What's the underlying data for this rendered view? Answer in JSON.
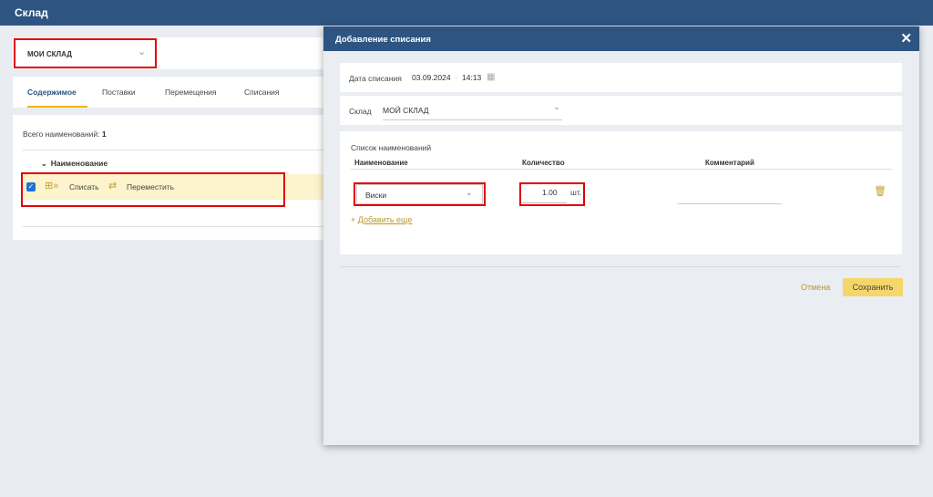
{
  "app": {
    "title": "Склад"
  },
  "warehouse_selector": {
    "value": "МОИ СКЛАД"
  },
  "tabs": [
    {
      "label": "Содержимое",
      "active": true
    },
    {
      "label": "Поставки"
    },
    {
      "label": "Перемещения"
    },
    {
      "label": "Списания"
    }
  ],
  "content": {
    "total_label": "Всего наименований:",
    "total_value": "1",
    "column_name": "Наименование",
    "actions": {
      "write_off": "Списать",
      "move": "Переместить"
    }
  },
  "modal": {
    "title": "Добавление списания",
    "date": {
      "label": "Дата списания",
      "date": "03.09.2024",
      "separator": "·",
      "time": "14:13"
    },
    "warehouse": {
      "label": "Склад",
      "value": "МОЙ СКЛАД"
    },
    "list": {
      "title": "Список наименований",
      "columns": {
        "name": "Наименование",
        "quantity": "Количество",
        "comment": "Комментарий"
      },
      "rows": [
        {
          "name": "Виски",
          "quantity": "1.00",
          "unit": "шт.",
          "comment": ""
        }
      ],
      "add_more": "Добавить еще"
    },
    "buttons": {
      "cancel": "Отмена",
      "save": "Сохранить"
    }
  },
  "colors": {
    "header": "#2e5481",
    "accent": "#f0b700",
    "highlight": "#fdf3cc",
    "red_outline": "#e10000",
    "save_button": "#f5d66a"
  }
}
